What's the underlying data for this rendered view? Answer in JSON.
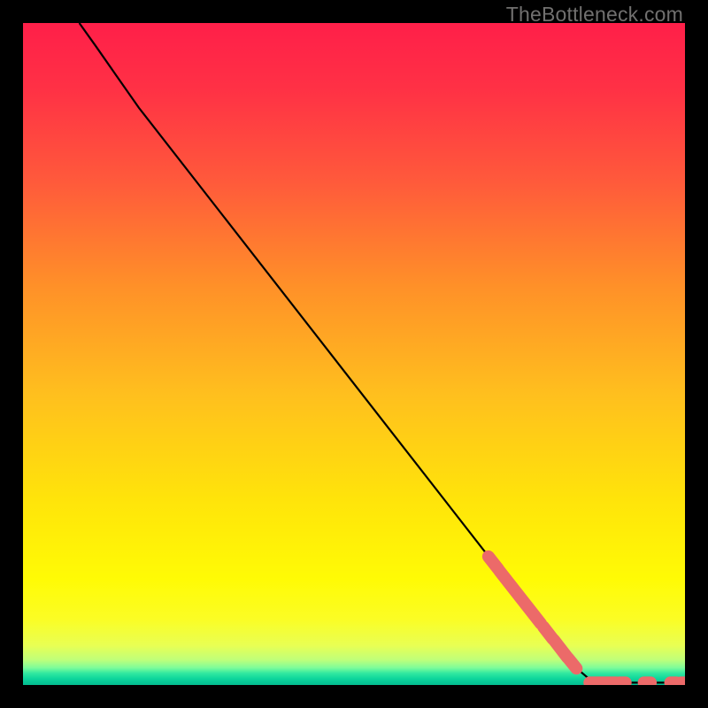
{
  "watermark": "TheBottleneck.com",
  "chart_data": {
    "type": "line",
    "title": "",
    "xlabel": "",
    "ylabel": "",
    "xlim": [
      0,
      100
    ],
    "ylim": [
      0,
      100
    ],
    "curve": [
      {
        "x": 8.5,
        "y": 100
      },
      {
        "x": 11,
        "y": 96.5
      },
      {
        "x": 14,
        "y": 92.2
      },
      {
        "x": 17.5,
        "y": 87.2
      },
      {
        "x": 83.2,
        "y": 2.9
      },
      {
        "x": 85.3,
        "y": 1.1
      },
      {
        "x": 87.8,
        "y": 0.35
      },
      {
        "x": 100,
        "y": 0.35
      }
    ],
    "marker_segments_along_curve": [
      {
        "x1": 70.3,
        "y1": 19.4,
        "x2": 71.8,
        "y2": 17.5
      },
      {
        "x1": 72.0,
        "y1": 17.2,
        "x2": 78.2,
        "y2": 9.3
      },
      {
        "x1": 78.6,
        "y1": 8.8,
        "x2": 80.0,
        "y2": 7.0
      },
      {
        "x1": 80.2,
        "y1": 6.8,
        "x2": 82.2,
        "y2": 4.2
      },
      {
        "x1": 82.4,
        "y1": 4.0,
        "x2": 83.6,
        "y2": 2.5
      }
    ],
    "marker_segments_bottom": [
      {
        "x1": 85.6,
        "y1": 0.35,
        "x2": 89.6,
        "y2": 0.35
      },
      {
        "x1": 90.1,
        "y1": 0.35,
        "x2": 91.0,
        "y2": 0.35
      },
      {
        "x1": 93.8,
        "y1": 0.35,
        "x2": 94.8,
        "y2": 0.35
      },
      {
        "x1": 97.8,
        "y1": 0.35,
        "x2": 98.7,
        "y2": 0.35
      },
      {
        "x1": 99.4,
        "y1": 0.35,
        "x2": 100.2,
        "y2": 0.35
      }
    ],
    "gradient_stops": [
      {
        "pct": 0,
        "color": "#ff1f49"
      },
      {
        "pct": 10,
        "color": "#ff3145"
      },
      {
        "pct": 24,
        "color": "#ff5a3b"
      },
      {
        "pct": 40,
        "color": "#ff9128"
      },
      {
        "pct": 56,
        "color": "#ffbf1e"
      },
      {
        "pct": 72,
        "color": "#ffe40a"
      },
      {
        "pct": 84,
        "color": "#fffb05"
      },
      {
        "pct": 90,
        "color": "#fbfd24"
      },
      {
        "pct": 94,
        "color": "#e9ff53"
      },
      {
        "pct": 96.2,
        "color": "#bfff7a"
      },
      {
        "pct": 97.4,
        "color": "#7dfc9a"
      },
      {
        "pct": 98.2,
        "color": "#33e9a0"
      },
      {
        "pct": 99.0,
        "color": "#0fd79c"
      },
      {
        "pct": 99.6,
        "color": "#06c595"
      },
      {
        "pct": 100,
        "color": "#04bd90"
      }
    ],
    "marker_color": "#ec6a69",
    "curve_color": "#000000"
  }
}
